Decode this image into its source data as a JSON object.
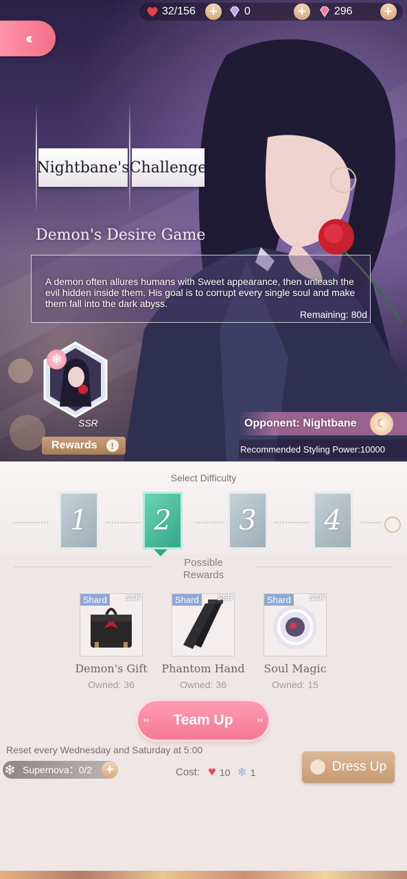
{
  "currency": {
    "stamina": "32/156",
    "diamonds": "0",
    "crystals": "296"
  },
  "title": {
    "part1": "Nightbane's",
    "part2": "Challenge",
    "subtitle": "Demon's Desire Game"
  },
  "description": "A demon often allures humans with Sweet appearance, then unleash the evil hidden inside them. His goal is to corrupt every single soul and make them fall into the dark abyss.",
  "remaining": "Remaining: 80d",
  "portrait_ssr": "SSR",
  "rewards_button": "Rewards",
  "opponent": "Opponent: Nightbane",
  "recommended_power": "Recommended Styling Power:10000",
  "difficulty": {
    "label": "Select Difficulty",
    "levels": [
      "1",
      "2",
      "3",
      "4"
    ],
    "selected": "2"
  },
  "possible_rewards_title": "Possible Rewards",
  "rewards": [
    {
      "tag": "Shard",
      "rarity": "SSR",
      "name": "Demon's Gift",
      "owned": "Owned: 36"
    },
    {
      "tag": "Shard",
      "rarity": "SSR",
      "name": "Phantom Hand",
      "owned": "Owned: 36"
    },
    {
      "tag": "Shard",
      "rarity": "SSR",
      "name": "Soul Magic",
      "owned": "Owned: 15"
    }
  ],
  "team_up_button": "Team Up",
  "reset_text": "Reset every Wednesday and Saturday at 5:00",
  "supernova": "Supernova：0/2",
  "cost": {
    "label": "Cost:",
    "hearts": "10",
    "supernova": "1"
  },
  "dress_up_button": "Dress Up",
  "colors": {
    "accent_pink": "#f47991",
    "selected_difficulty": "#33a589",
    "gold": "#c69a71"
  }
}
